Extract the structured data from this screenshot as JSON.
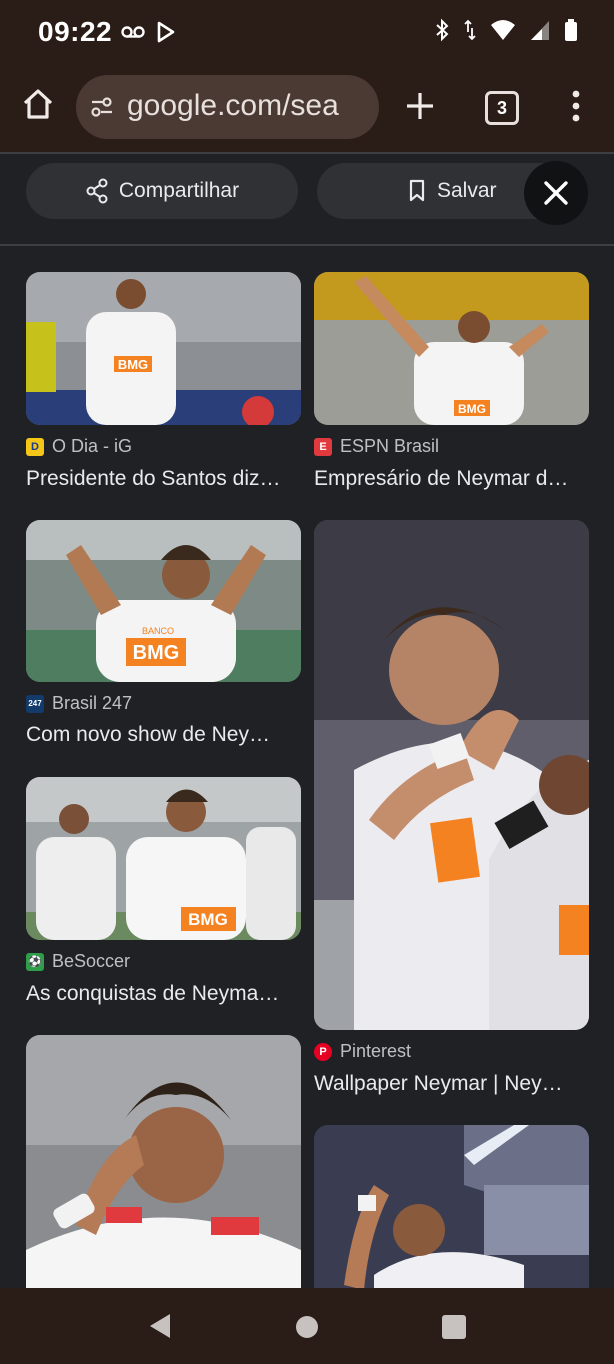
{
  "status": {
    "time": "09:22",
    "left_icons": [
      "voicemail-icon",
      "play-store-icon"
    ],
    "right_icons": [
      "bluetooth-icon",
      "data-arrows-icon",
      "wifi-icon",
      "signal-icon",
      "battery-icon"
    ]
  },
  "browser": {
    "url": "google.com/sea",
    "tab_count": "3"
  },
  "actions": {
    "share_label": "Compartilhar",
    "save_label": "Salvar"
  },
  "colors": {
    "page_bg": "#202124",
    "chrome_bg": "#2a1c17",
    "chip_bg": "#303134",
    "url_pill_bg": "#4a3a33"
  },
  "results": {
    "left": [
      {
        "source": "O Dia - iG",
        "title": "Presidente do Santos diz…",
        "favicon": "D",
        "favicon_bg": "#f5c518",
        "favicon_fg": "#1a3c8f"
      },
      {
        "source": "Brasil 247",
        "title": "Com novo show de Ney…",
        "favicon": "247",
        "favicon_bg": "#123a6b",
        "favicon_fg": "#ffffff"
      },
      {
        "source": "BeSoccer",
        "title": "As conquistas de Neyma…",
        "favicon": "⚽",
        "favicon_bg": "#2e9e4a",
        "favicon_fg": "#ffffff"
      },
      {
        "source": "",
        "title": "",
        "favicon": "",
        "favicon_bg": "",
        "favicon_fg": ""
      }
    ],
    "right": [
      {
        "source": "ESPN Brasil",
        "title": "Empresário de Neymar d…",
        "favicon": "E",
        "favicon_bg": "#e03a3e",
        "favicon_fg": "#ffffff"
      },
      {
        "source": "Pinterest",
        "title": "Wallpaper Neymar | Ney…",
        "favicon": "P",
        "favicon_bg": "#e60023",
        "favicon_fg": "#ffffff"
      },
      {
        "source": "",
        "title": "",
        "favicon": "",
        "favicon_bg": "",
        "favicon_fg": ""
      }
    ]
  },
  "image_text": {
    "sponsor": "BMG",
    "sponsor_small": "BANCO"
  }
}
